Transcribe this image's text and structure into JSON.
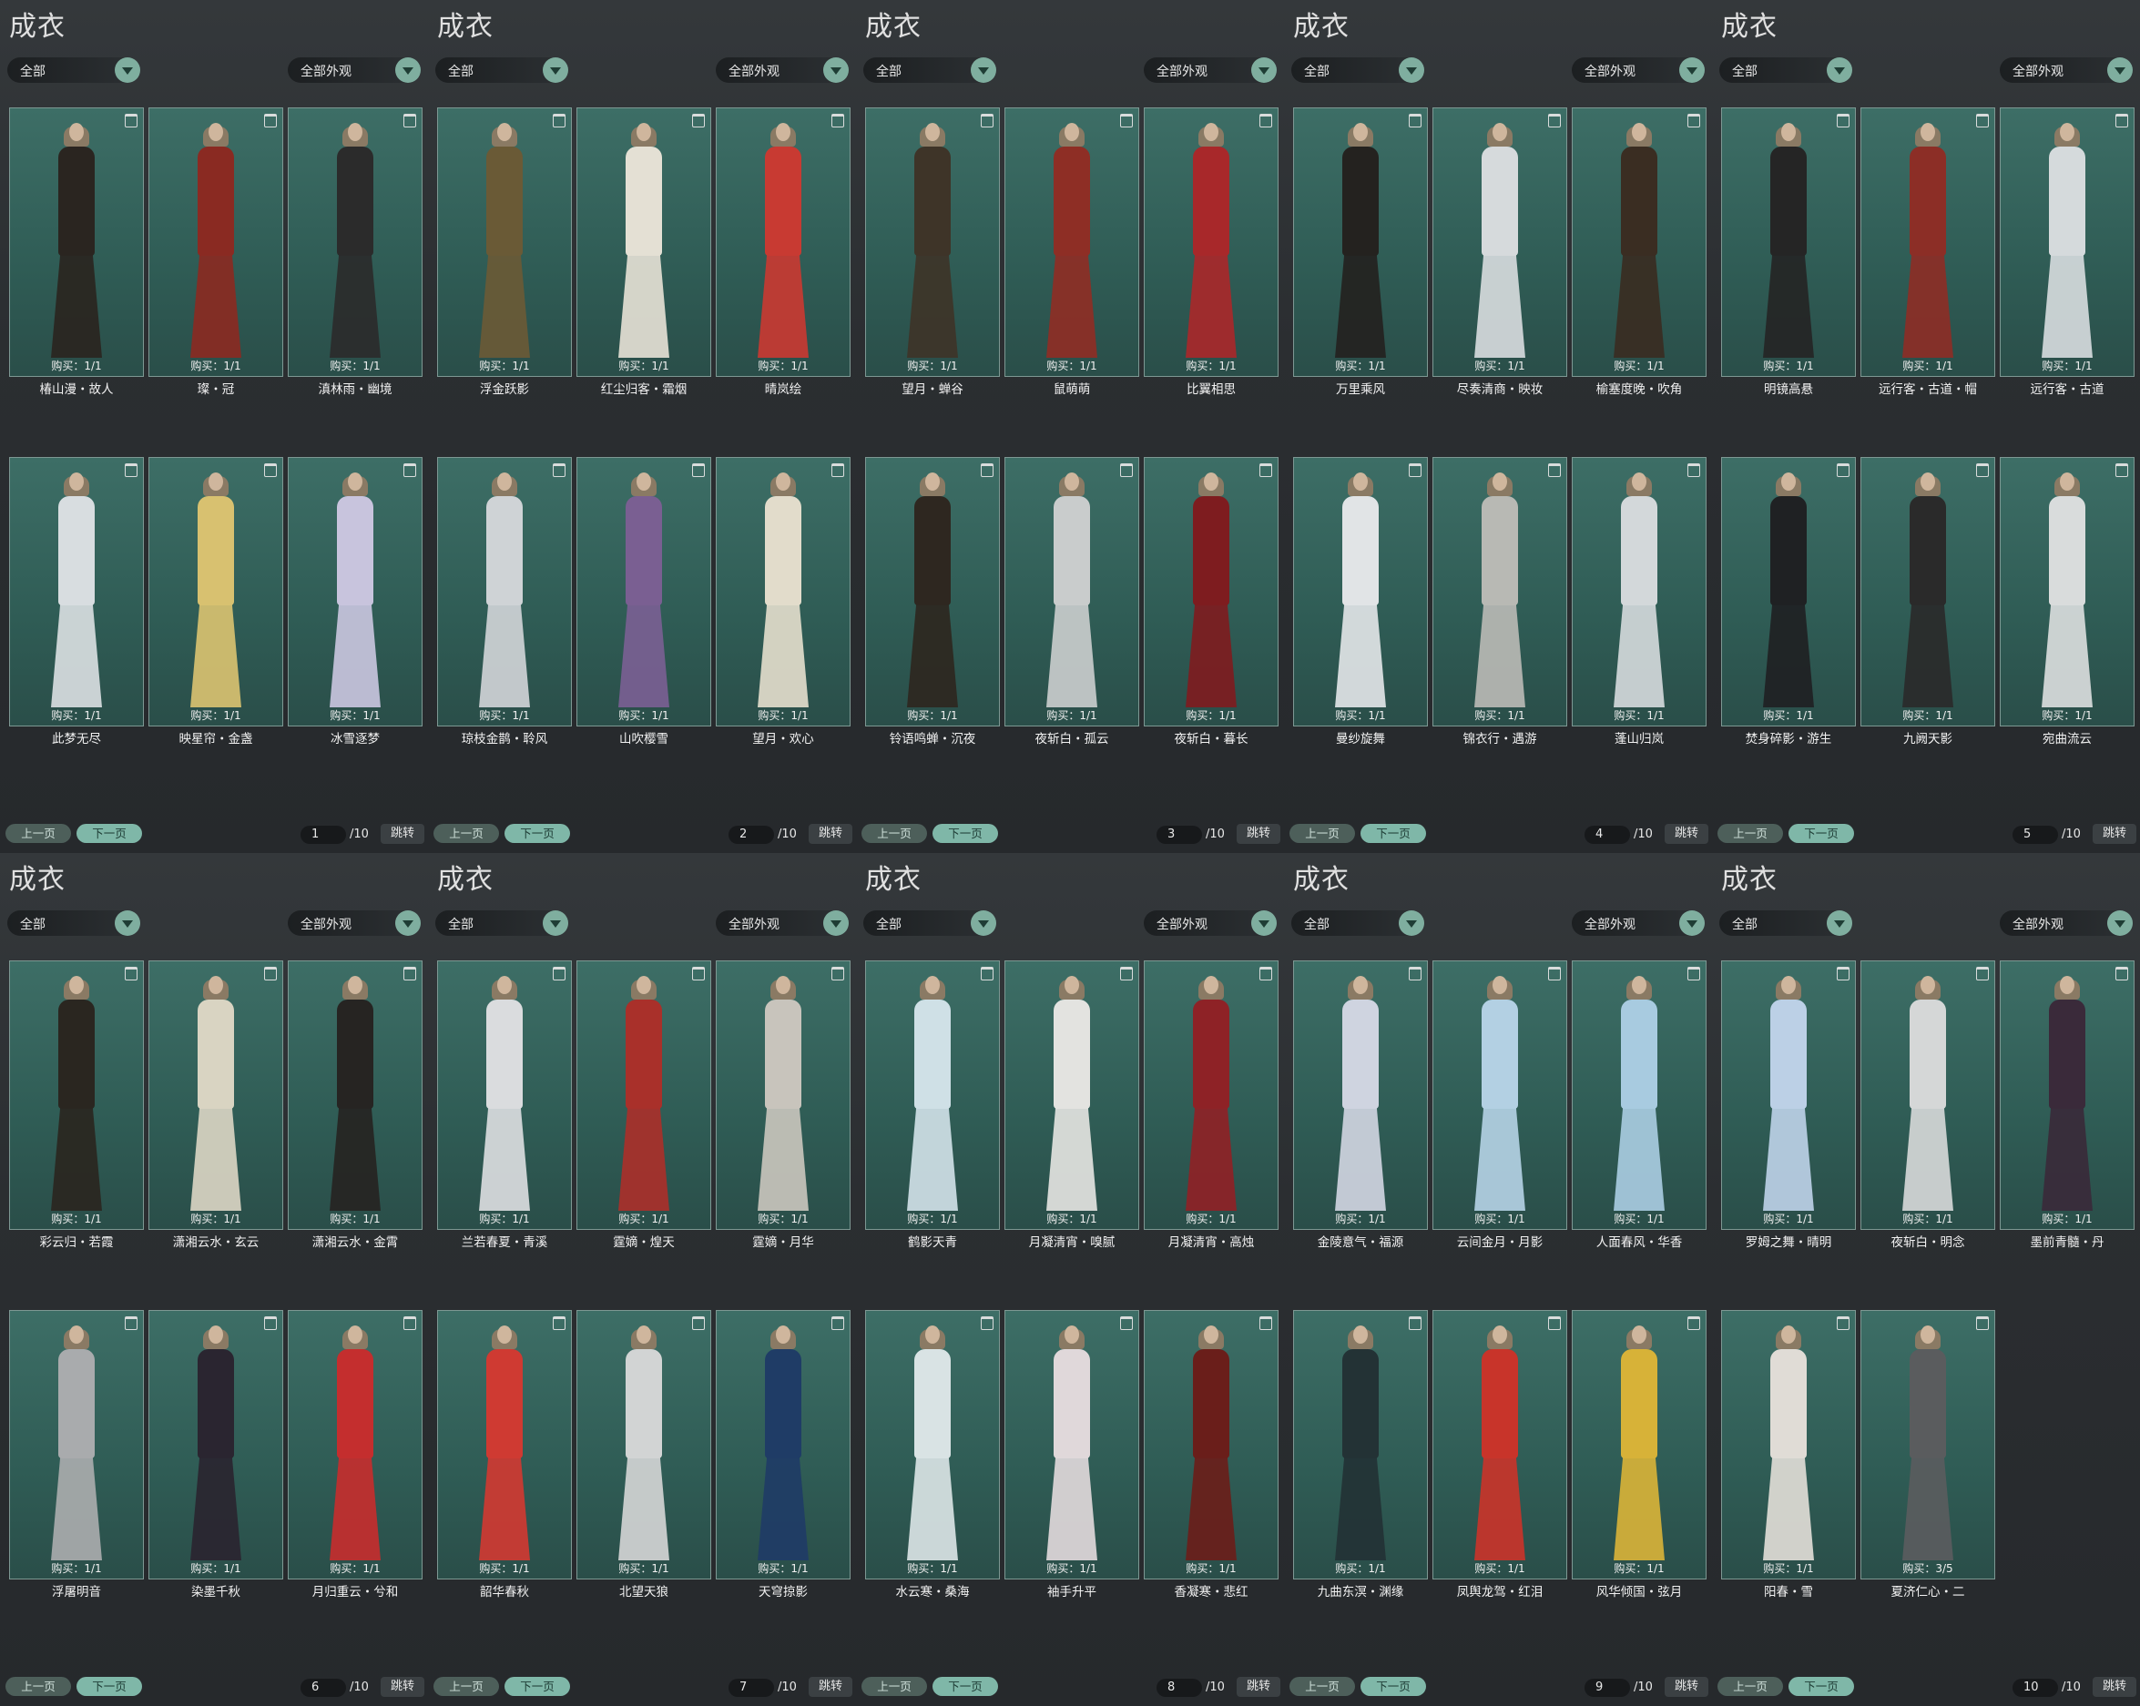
{
  "panels": [
    {
      "title": "成衣",
      "filter_category": "全部",
      "filter_look": "全部外观",
      "page": "1",
      "total": "/10",
      "prev_label": "上一页",
      "next_label": "下一页",
      "jump_label": "跳转",
      "items": [
        {
          "name": "椿山漫・故人",
          "buy": "购买：1/1",
          "color": "#2a2520"
        },
        {
          "name": "璨・冠",
          "buy": "购买：1/1",
          "color": "#8a2a22"
        },
        {
          "name": "滇林雨・幽境",
          "buy": "购买：1/1",
          "color": "#2b2b2b"
        },
        {
          "name": "此梦无尽",
          "buy": "购买：1/1",
          "color": "#d8dde0"
        },
        {
          "name": "映星帘・金盏",
          "buy": "购买：1/1",
          "color": "#d8c170"
        },
        {
          "name": "冰雪逐梦",
          "buy": "购买：1/1",
          "color": "#c8c4dd"
        }
      ]
    },
    {
      "title": "成衣",
      "filter_category": "全部",
      "filter_look": "全部外观",
      "page": "2",
      "total": "/10",
      "prev_label": "上一页",
      "next_label": "下一页",
      "jump_label": "跳转",
      "items": [
        {
          "name": "浮金跃影",
          "buy": "购买：1/1",
          "color": "#6a5a36"
        },
        {
          "name": "红尘归客・霜烟",
          "buy": "购买：1/1",
          "color": "#e4e0d4"
        },
        {
          "name": "晴岚绘",
          "buy": "购买：1/1",
          "color": "#c83a32"
        },
        {
          "name": "琼枝金鹊・聆风",
          "buy": "购买：1/1",
          "color": "#cfd3d6"
        },
        {
          "name": "山吹樱雪",
          "buy": "购买：1/1",
          "color": "#7a5f92"
        },
        {
          "name": "望月・欢心",
          "buy": "购买：1/1",
          "color": "#e2dccb"
        }
      ]
    },
    {
      "title": "成衣",
      "filter_category": "全部",
      "filter_look": "全部外观",
      "page": "3",
      "total": "/10",
      "prev_label": "上一页",
      "next_label": "下一页",
      "jump_label": "跳转",
      "items": [
        {
          "name": "望月・蝉谷",
          "buy": "购买：1/1",
          "color": "#3e3428"
        },
        {
          "name": "鼠萌萌",
          "buy": "购买：1/1",
          "color": "#8e2e25"
        },
        {
          "name": "比翼相思",
          "buy": "购买：1/1",
          "color": "#a8282a"
        },
        {
          "name": "铃语鸣蝉・沉夜",
          "buy": "购买：1/1",
          "color": "#2e2720"
        },
        {
          "name": "夜斩白・孤云",
          "buy": "购买：1/1",
          "color": "#c9cccc"
        },
        {
          "name": "夜斩白・暮长",
          "buy": "购买：1/1",
          "color": "#7e1c1f"
        }
      ]
    },
    {
      "title": "成衣",
      "filter_category": "全部",
      "filter_look": "全部外观",
      "page": "4",
      "total": "/10",
      "prev_label": "上一页",
      "next_label": "下一页",
      "jump_label": "跳转",
      "items": [
        {
          "name": "万里乘风",
          "buy": "购买：1/1",
          "color": "#24221f"
        },
        {
          "name": "尽奏清商・映妆",
          "buy": "购买：1/1",
          "color": "#d6dadc"
        },
        {
          "name": "榆塞度晚・吹角",
          "buy": "购买：1/1",
          "color": "#3a2d22"
        },
        {
          "name": "曼纱旋舞",
          "buy": "购买：1/1",
          "color": "#e1e4e6"
        },
        {
          "name": "锦衣行・遇游",
          "buy": "购买：1/1",
          "color": "#b8b9b4"
        },
        {
          "name": "蓬山归岚",
          "buy": "购买：1/1",
          "color": "#d3d8da"
        }
      ]
    },
    {
      "title": "成衣",
      "filter_category": "全部",
      "filter_look": "全部外观",
      "page": "5",
      "total": "/10",
      "prev_label": "上一页",
      "next_label": "下一页",
      "jump_label": "跳转",
      "items": [
        {
          "name": "明镜高悬",
          "buy": "购买：1/1",
          "color": "#252525"
        },
        {
          "name": "远行客・古道・帽",
          "buy": "购买：1/1",
          "color": "#8c2e26"
        },
        {
          "name": "远行客・古道",
          "buy": "购买：1/1",
          "color": "#d5dadc"
        },
        {
          "name": "焚身碎影・游生",
          "buy": "购买：1/1",
          "color": "#1f2123"
        },
        {
          "name": "九阙天影",
          "buy": "购买：1/1",
          "color": "#2a2a2a"
        },
        {
          "name": "宛曲流云",
          "buy": "购买：1/1",
          "color": "#d9dcdc"
        }
      ]
    },
    {
      "title": "成衣",
      "filter_category": "全部",
      "filter_look": "全部外观",
      "page": "6",
      "total": "/10",
      "prev_label": "上一页",
      "next_label": "下一页",
      "jump_label": "跳转",
      "items": [
        {
          "name": "彩云归・若霞",
          "buy": "购买：1/1",
          "color": "#2a2620"
        },
        {
          "name": "潇湘云水・玄云",
          "buy": "购买：1/1",
          "color": "#d9d4c2"
        },
        {
          "name": "潇湘云水・金霄",
          "buy": "购买：1/1",
          "color": "#262422"
        },
        {
          "name": "浮屠明音",
          "buy": "购买：1/1",
          "color": "#a9abad"
        },
        {
          "name": "染墨千秋",
          "buy": "购买：1/1",
          "color": "#2a2530"
        },
        {
          "name": "月归重云・兮和",
          "buy": "购买：1/1",
          "color": "#c42e2e"
        }
      ]
    },
    {
      "title": "成衣",
      "filter_category": "全部",
      "filter_look": "全部外观",
      "page": "7",
      "total": "/10",
      "prev_label": "上一页",
      "next_label": "下一页",
      "jump_label": "跳转",
      "items": [
        {
          "name": "兰若春夏・青溪",
          "buy": "购买：1/1",
          "color": "#dadcde"
        },
        {
          "name": "霆嫡・煌天",
          "buy": "购买：1/1",
          "color": "#a9302a"
        },
        {
          "name": "霆嫡・月华",
          "buy": "购买：1/1",
          "color": "#c8c4bc"
        },
        {
          "name": "韶华春秋",
          "buy": "购买：1/1",
          "color": "#cf3a32"
        },
        {
          "name": "北望天狼",
          "buy": "购买：1/1",
          "color": "#d2d4d4"
        },
        {
          "name": "天穹掠影",
          "buy": "购买：1/1",
          "color": "#1f3c66"
        }
      ]
    },
    {
      "title": "成衣",
      "filter_category": "全部",
      "filter_look": "全部外观",
      "page": "8",
      "total": "/10",
      "prev_label": "上一页",
      "next_label": "下一页",
      "jump_label": "跳转",
      "items": [
        {
          "name": "鹤影天青",
          "buy": "购买：1/1",
          "color": "#cfe0e6"
        },
        {
          "name": "月凝清宵・嗅腻",
          "buy": "购买：1/1",
          "color": "#e3e3e0"
        },
        {
          "name": "月凝清宵・高烛",
          "buy": "购买：1/1",
          "color": "#8e2226"
        },
        {
          "name": "水云寒・桑海",
          "buy": "购买：1/1",
          "color": "#d9e3e4"
        },
        {
          "name": "袖手升平",
          "buy": "购买：1/1",
          "color": "#e0d8da"
        },
        {
          "name": "香凝寒・悲红",
          "buy": "购买：1/1",
          "color": "#6a1e1a"
        }
      ]
    },
    {
      "title": "成衣",
      "filter_category": "全部",
      "filter_look": "全部外观",
      "page": "9",
      "total": "/10",
      "prev_label": "上一页",
      "next_label": "下一页",
      "jump_label": "跳转",
      "items": [
        {
          "name": "金陵意气・福源",
          "buy": "购买：1/1",
          "color": "#cfd4e0"
        },
        {
          "name": "云间金月・月影",
          "buy": "购买：1/1",
          "color": "#b3d0e3"
        },
        {
          "name": "人面春风・华香",
          "buy": "购买：1/1",
          "color": "#a8cbe0"
        },
        {
          "name": "九曲东溟・渊缘",
          "buy": "购买：1/1",
          "color": "#233235"
        },
        {
          "name": "凤舆龙驾・红泪",
          "buy": "购买：1/1",
          "color": "#c8342a"
        },
        {
          "name": "风华倾国・弦月",
          "buy": "购买：1/1",
          "color": "#d7b238"
        }
      ]
    },
    {
      "title": "成衣",
      "filter_category": "全部",
      "filter_look": "全部外观",
      "page": "10",
      "total": "/10",
      "prev_label": "上一页",
      "next_label": "下一页",
      "jump_label": "跳转",
      "items": [
        {
          "name": "罗姆之舞・晴明",
          "buy": "购买：1/1",
          "color": "#bcd0e6"
        },
        {
          "name": "夜斩白・明念",
          "buy": "购买：1/1",
          "color": "#d5d7d7"
        },
        {
          "name": "墨前青髓・丹",
          "buy": "购买：1/1",
          "color": "#3a2a3a"
        },
        {
          "name": "阳春・雪",
          "buy": "购买：1/1",
          "color": "#e0dcd6"
        },
        {
          "name": "夏济仁心・二",
          "buy": "购买：3/5",
          "color": "#5a5c5e"
        }
      ]
    }
  ]
}
